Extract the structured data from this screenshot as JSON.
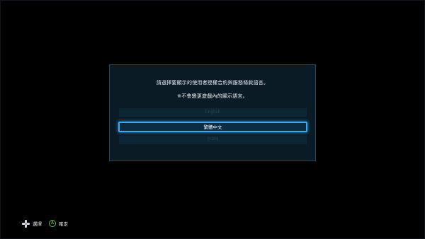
{
  "dialog": {
    "message_line1": "請選擇要顯示的使用者授權合約與服務條款語言。",
    "message_line2": "※不會變更遊戲內的顯示語言。",
    "options": [
      {
        "label": "English",
        "selected": false
      },
      {
        "label": "繁體中文",
        "selected": true
      },
      {
        "label": "한국어",
        "selected": false
      }
    ]
  },
  "hints": {
    "select_label": "選擇",
    "a_button_glyph": "A",
    "confirm_label": "確定",
    "select_icon": "dpad-icon",
    "confirm_icon": "a-button-icon"
  },
  "colors": {
    "background": "#000000",
    "dialog_bg": "#0b1b25",
    "dialog_border": "#23475f",
    "selection_accent": "#3aa9f0",
    "a_button_green": "#6fc04a"
  }
}
